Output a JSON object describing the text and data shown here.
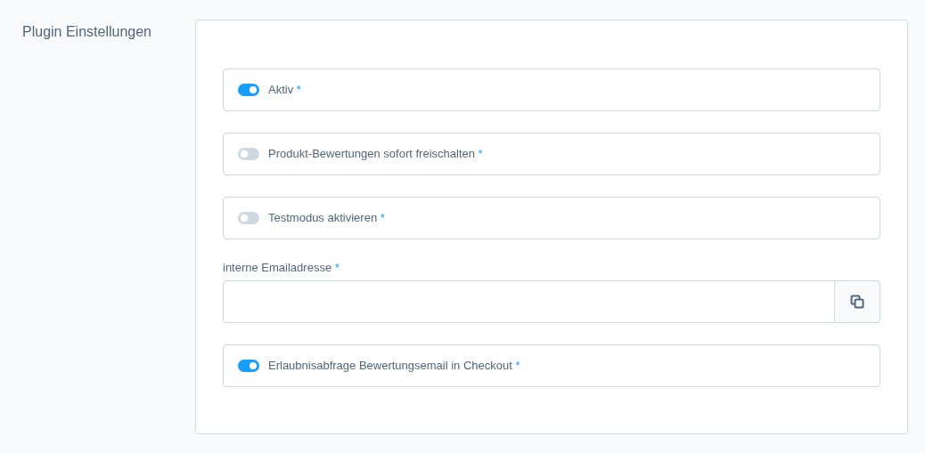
{
  "section_title": "Plugin Einstellungen",
  "fields": [
    {
      "kind": "toggle",
      "label": "Aktiv",
      "required_mark": "*",
      "on": true
    },
    {
      "kind": "toggle",
      "label": "Produkt-Bewertungen sofort freischalten",
      "required_mark": "*",
      "on": false
    },
    {
      "kind": "toggle",
      "label": "Testmodus aktivieren",
      "required_mark": "*",
      "on": false
    },
    {
      "kind": "text",
      "label": "interne Emailadresse",
      "required_mark": "*"
    },
    {
      "kind": "toggle",
      "label": "Erlaubnisabfrage Bewertungsemail in Checkout",
      "required_mark": "*",
      "on": true
    }
  ]
}
